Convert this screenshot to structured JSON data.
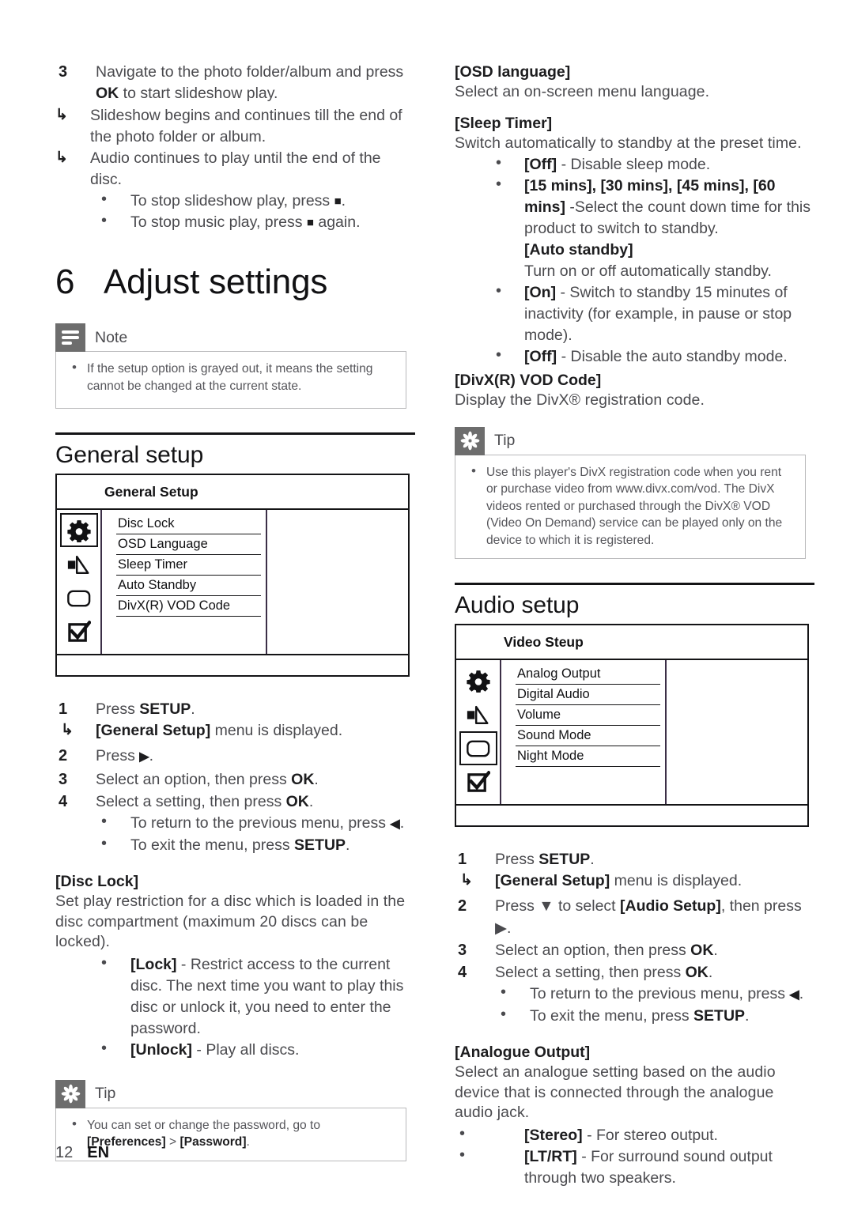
{
  "page": {
    "number": "12",
    "language": "EN"
  },
  "left_column": {
    "step3": {
      "num": "3",
      "text_1": "Navigate to the photo folder/album and press ",
      "bold_1": "OK",
      "text_2": " to start slideshow play.",
      "results": [
        "Slideshow begins and continues till the end of the photo folder or album.",
        "Audio continues to play until the end of the disc."
      ],
      "bullets": [
        "To stop slideshow play, press ",
        "To stop music play, press "
      ],
      "bullet_tail_2": " again."
    },
    "chapter": {
      "number": "6",
      "title": "Adjust settings"
    },
    "note": {
      "label": "Note",
      "icon": "note-icon",
      "text": "If the setup option is grayed out, it means the setting cannot be changed at the current state."
    },
    "general_setup": {
      "heading": "General setup",
      "osd": {
        "title": "General Setup",
        "icons": [
          "gear-icon",
          "speaker-icon",
          "rounded-rect-icon",
          "checkbox-icon"
        ],
        "selected_icon_index": 0,
        "items": [
          "Disc Lock",
          "OSD Language",
          "Sleep Timer",
          "Auto Standby",
          "DivX(R) VOD Code"
        ]
      },
      "steps": [
        {
          "num": "1",
          "text": "Press ",
          "bold": "SETUP",
          "tail": ".",
          "result_bold": "[General Setup]",
          "result_tail": " menu is displayed."
        },
        {
          "num": "2",
          "text": "Press ",
          "bold": "▶",
          "tail": "."
        },
        {
          "num": "3",
          "text": "Select an option, then press ",
          "bold": "OK",
          "tail": "."
        },
        {
          "num": "4",
          "text": "Select a setting, then press ",
          "bold": "OK",
          "tail": "."
        }
      ],
      "sub_bullets": [
        {
          "text": "To return to the previous menu, press ",
          "bold": "◀",
          "tail": "."
        },
        {
          "text": "To exit the menu, press ",
          "bold": "SETUP",
          "tail": "."
        }
      ]
    },
    "disc_lock": {
      "title": "[Disc Lock]",
      "body": "Set play restriction for a disc which is loaded in the disc compartment (maximum 20 discs can be locked).",
      "options": [
        {
          "bold": "[Lock]",
          "text": " - Restrict access to the current disc. The next time you want to play this disc or unlock it, you need to enter the password."
        },
        {
          "bold": "[Unlock]",
          "text": " - Play all discs."
        }
      ]
    },
    "tip": {
      "label": "Tip",
      "icon": "tip-star-icon",
      "text_1": "You can set or change the password, go to ",
      "bold_1": "[Preferences]",
      "text_2": " > ",
      "bold_2": "[Password]",
      "text_3": "."
    }
  },
  "right_column": {
    "osd_language": {
      "title": "[OSD language]",
      "body": "Select an on-screen menu language."
    },
    "sleep_timer": {
      "title": "[Sleep Timer]",
      "body": "Switch automatically to standby at the preset time.",
      "options": [
        {
          "bold": "[Off]",
          "text": " - Disable sleep mode."
        },
        {
          "bold": "[15 mins], [30 mins], [45 mins], [60 mins]",
          "text": " -Select the count down time for this product to switch to standby."
        }
      ]
    },
    "auto_standby": {
      "title": "[Auto standby]",
      "body": "Turn on or off automatically standby.",
      "options": [
        {
          "bold": "[On]",
          "text": " - Switch to standby 15 minutes of inactivity (for example, in pause or stop mode)."
        },
        {
          "bold": "[Off]",
          "text": " - Disable the auto standby mode."
        }
      ]
    },
    "divx_vod": {
      "title": "[DivX(R) VOD Code]",
      "body": "Display the DivX® registration code."
    },
    "tip": {
      "label": "Tip",
      "icon": "tip-star-icon",
      "text": "Use this player's DivX registration code when you rent or purchase video from www.divx.com/vod. The DivX videos rented or purchased through the DivX® VOD (Video On Demand) service can be played only on the device to which it is registered."
    },
    "audio_setup": {
      "heading": "Audio setup",
      "osd": {
        "title": "Video Steup",
        "icons": [
          "gear-icon",
          "speaker-icon",
          "rounded-rect-icon",
          "checkbox-icon"
        ],
        "selected_icon_index": 2,
        "items": [
          "Analog Output",
          "Digital Audio",
          "Volume",
          "Sound Mode",
          "Night Mode"
        ]
      },
      "steps": [
        {
          "num": "1",
          "text": "Press ",
          "bold": "SETUP",
          "tail": ".",
          "result_bold": "[General Setup]",
          "result_tail": " menu is displayed."
        },
        {
          "num": "2",
          "text": "Press ▼ to select ",
          "bold": "[Audio Setup]",
          "tail": ", then press ▶."
        },
        {
          "num": "3",
          "text": "Select an option, then press ",
          "bold": "OK",
          "tail": "."
        },
        {
          "num": "4",
          "text": "Select a setting, then press ",
          "bold": "OK",
          "tail": "."
        }
      ],
      "sub_bullets": [
        {
          "text": "To return to the previous menu, press ",
          "bold": "◀",
          "tail": "."
        },
        {
          "text": "To exit the menu, press ",
          "bold": "SETUP",
          "tail": "."
        }
      ]
    },
    "analogue_output": {
      "title": "[Analogue Output]",
      "body": "Select an analogue setting based on the audio device that is connected through the analogue audio jack.",
      "options": [
        {
          "bold": "[Stereo]",
          "text": " - For stereo output."
        },
        {
          "bold": "[LT/RT]",
          "text": " - For surround sound output through two speakers."
        }
      ]
    }
  }
}
